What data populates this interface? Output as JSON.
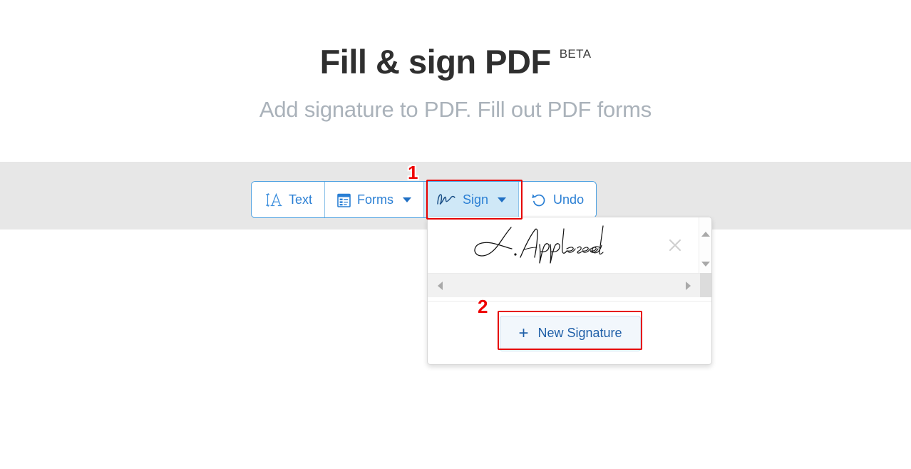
{
  "header": {
    "title": "Fill & sign PDF",
    "badge": "BETA",
    "subtitle": "Add signature to PDF. Fill out PDF forms"
  },
  "toolbar": {
    "buttons": [
      {
        "label": "Text",
        "icon": "text-cursor-a-icon",
        "has_caret": false,
        "active": false
      },
      {
        "label": "Forms",
        "icon": "form-clipboard-icon",
        "has_caret": true,
        "active": false
      },
      {
        "label": "Sign",
        "icon": "signature-stroke-icon",
        "has_caret": true,
        "active": true
      },
      {
        "label": "Undo",
        "icon": "undo-arrow-icon",
        "has_caret": false,
        "active": false
      }
    ]
  },
  "sign_dropdown": {
    "saved_signature": {
      "name": "J. Appleseed",
      "close_icon": "close-x-icon"
    },
    "vertical_scrollbar": {
      "up_icon": "triangle-up-icon",
      "down_icon": "triangle-down-icon"
    },
    "horizontal_scrollbar": {
      "left_icon": "triangle-left-icon",
      "right_icon": "triangle-right-icon"
    },
    "new_signature": {
      "label": "New Signature",
      "plus_icon": "plus-icon"
    }
  },
  "annotations": {
    "markers": [
      {
        "number": "1",
        "target": "Sign"
      },
      {
        "number": "2",
        "target": "New Signature"
      }
    ],
    "highlight_color": "#e60000"
  },
  "colors": {
    "accent_blue": "#2a7fd4",
    "band_gray": "#e7e7e7",
    "active_blue": "#cfe8f7",
    "subtitle_gray": "#aab2ba"
  }
}
